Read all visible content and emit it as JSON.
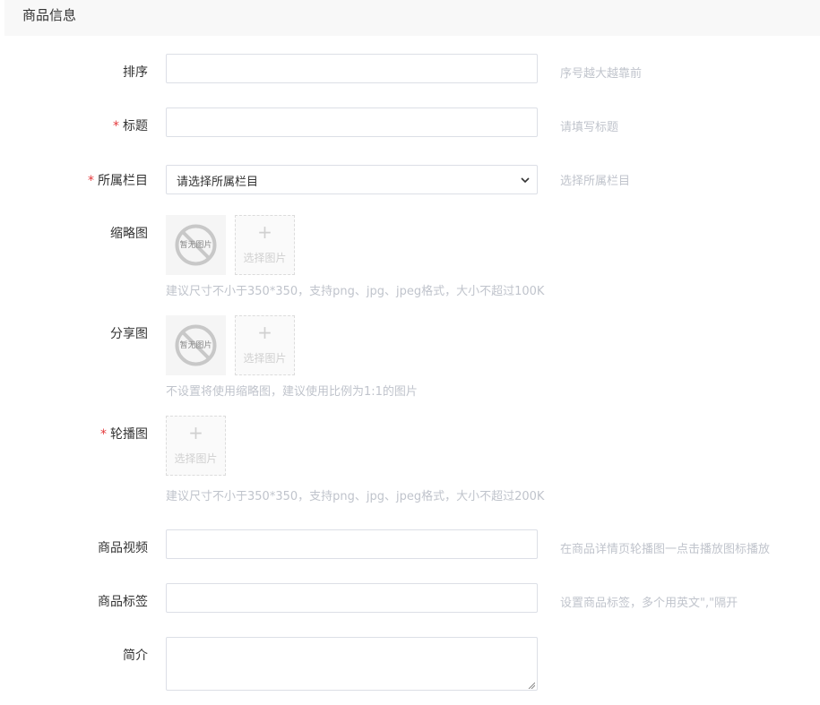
{
  "section": {
    "title": "商品信息"
  },
  "form": {
    "sort": {
      "label": "排序",
      "value": "",
      "hint": "序号越大越靠前"
    },
    "title": {
      "required": "*",
      "label": "标题",
      "value": "",
      "hint": "请填写标题"
    },
    "category": {
      "required": "*",
      "label": "所属栏目",
      "selected": "请选择所属栏目",
      "hint": "选择所属栏目"
    },
    "thumbnail": {
      "label": "缩略图",
      "placeholder_text": "暂无图片",
      "upload_plus": "+",
      "upload_label": "选择图片",
      "tip": "建议尺寸不小于350*350，支持png、jpg、jpeg格式，大小不超过100K"
    },
    "share_image": {
      "label": "分享图",
      "placeholder_text": "暂无图片",
      "upload_plus": "+",
      "upload_label": "选择图片",
      "tip": "不设置将使用缩略图，建议使用比例为1:1的图片"
    },
    "carousel": {
      "required": "*",
      "label": "轮播图",
      "upload_plus": "+",
      "upload_label": "选择图片",
      "tip": "建议尺寸不小于350*350，支持png、jpg、jpeg格式，大小不超过200K"
    },
    "video": {
      "label": "商品视频",
      "value": "",
      "hint": "在商品详情页轮播图一点击播放图标播放"
    },
    "tags": {
      "label": "商品标签",
      "value": "",
      "hint": "设置商品标签，多个用英文\",\"隔开"
    },
    "intro": {
      "label": "简介",
      "value": ""
    }
  },
  "colors": {
    "required": "#e4393c",
    "hint": "#c0c4cc",
    "border": "#dcdfe6",
    "header_bg": "#f8f8f8"
  }
}
